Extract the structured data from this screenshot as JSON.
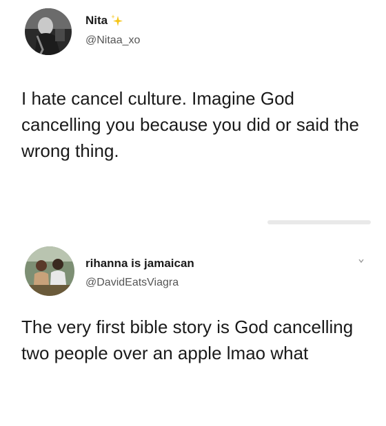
{
  "tweets": [
    {
      "display_name": "Nita",
      "handle": "@Nitaa_xo",
      "badge_icon": "sparkle-icon",
      "text": "I hate cancel culture. Imagine God cancelling you because you did or said the wrong thing."
    },
    {
      "display_name": "rihanna is jamaican",
      "handle": "@DavidEatsViagra",
      "menu_icon": "chevron-down-icon",
      "text": "The very first bible story is God cancelling two people over an apple lmao what"
    }
  ],
  "colors": {
    "background": "#ffffff",
    "text": "#1a1a1a",
    "handle": "#555555",
    "sparkle": "#f5c518"
  }
}
